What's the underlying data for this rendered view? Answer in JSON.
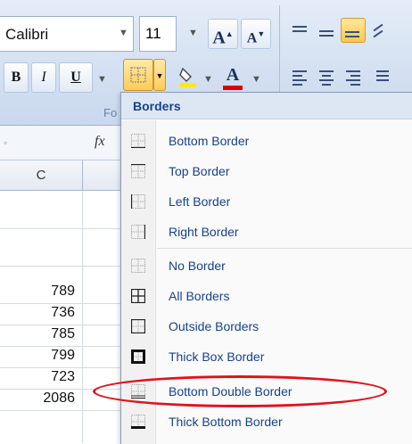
{
  "ribbon": {
    "font_name": "Calibri",
    "font_size": "11",
    "grow_font_label": "A",
    "shrink_font_label": "A",
    "bold_label": "B",
    "italic_label": "I",
    "underline_label": "U",
    "font_color_label": "A",
    "font_group_label": "Fo",
    "font_color_accent": "#e00000",
    "fill_color_accent": "#ffea00"
  },
  "formula_bar": {
    "fx_label": "fx"
  },
  "sheet": {
    "column_header": "C",
    "values": [
      "789",
      "736",
      "785",
      "799",
      "723",
      "2086"
    ]
  },
  "borders_menu": {
    "title": "Borders",
    "items": [
      {
        "label": "Bottom Border",
        "icon": "bottom-border-icon"
      },
      {
        "label": "Top Border",
        "icon": "top-border-icon"
      },
      {
        "label": "Left Border",
        "icon": "left-border-icon"
      },
      {
        "label": "Right Border",
        "icon": "right-border-icon"
      },
      {
        "label": "No Border",
        "icon": "no-border-icon"
      },
      {
        "label": "All Borders",
        "icon": "all-borders-icon"
      },
      {
        "label": "Outside Borders",
        "icon": "outside-borders-icon"
      },
      {
        "label": "Thick Box Border",
        "icon": "thick-box-border-icon"
      },
      {
        "label": "Bottom Double Border",
        "icon": "bottom-double-border-icon"
      },
      {
        "label": "Thick Bottom Border",
        "icon": "thick-bottom-border-icon"
      }
    ],
    "highlight_color": "#e0121b"
  }
}
